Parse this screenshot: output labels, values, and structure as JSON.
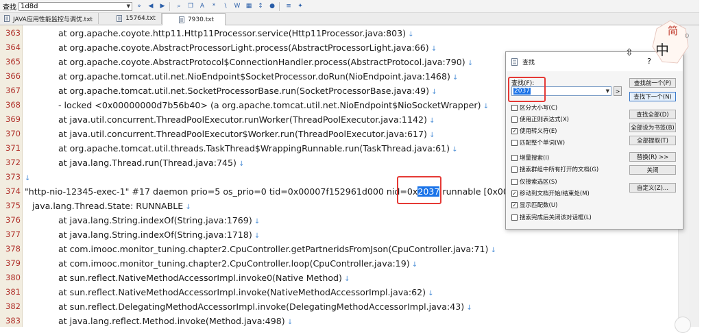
{
  "toolbar": {
    "search_label": "查找",
    "search_value": "1d8d"
  },
  "tabs": [
    {
      "label": "JAVA应用性能监控与调优.txt"
    },
    {
      "label": "15764.txt"
    },
    {
      "label": "7930.txt"
    }
  ],
  "editor": {
    "lines": [
      {
        "num": "363",
        "text": "at org.apache.coyote.http11.Http11Processor.service(Http11Processor.java:803)",
        "indent": 2
      },
      {
        "num": "364",
        "text": "at org.apache.coyote.AbstractProcessorLight.process(AbstractProcessorLight.java:66)",
        "indent": 2
      },
      {
        "num": "365",
        "text": "at org.apache.coyote.AbstractProtocol$ConnectionHandler.process(AbstractProtocol.java:790)",
        "indent": 2
      },
      {
        "num": "366",
        "text": "at org.apache.tomcat.util.net.NioEndpoint$SocketProcessor.doRun(NioEndpoint.java:1468)",
        "indent": 2
      },
      {
        "num": "367",
        "text": "at org.apache.tomcat.util.net.SocketProcessorBase.run(SocketProcessorBase.java:49)",
        "indent": 2
      },
      {
        "num": "368",
        "text": "- locked <0x00000000d7b56b40> (a org.apache.tomcat.util.net.NioEndpoint$NioSocketWrapper)",
        "indent": 2
      },
      {
        "num": "369",
        "text": "at java.util.concurrent.ThreadPoolExecutor.runWorker(ThreadPoolExecutor.java:1142)",
        "indent": 2
      },
      {
        "num": "370",
        "text": "at java.util.concurrent.ThreadPoolExecutor$Worker.run(ThreadPoolExecutor.java:617)",
        "indent": 2
      },
      {
        "num": "371",
        "text": "at org.apache.tomcat.util.threads.TaskThread$WrappingRunnable.run(TaskThread.java:61)",
        "indent": 2
      },
      {
        "num": "372",
        "text": "at java.lang.Thread.run(Thread.java:745)",
        "indent": 2
      },
      {
        "num": "373",
        "text": "",
        "indent": 0
      },
      {
        "num": "374",
        "pre": "\"http-nio-12345-exec-1\" #17 daemon prio=5 os_prio=0 tid=0x00007f152961d000 nid=0x",
        "match": "2037",
        "post": " runnable [0x0000",
        "indent": 0
      },
      {
        "num": "375",
        "text": "java.lang.Thread.State: RUNNABLE",
        "indent": 1
      },
      {
        "num": "376",
        "text": "at java.lang.String.indexOf(String.java:1769)",
        "indent": 2
      },
      {
        "num": "377",
        "text": "at java.lang.String.indexOf(String.java:1718)",
        "indent": 2
      },
      {
        "num": "378",
        "text": "at com.imooc.monitor_tuning.chapter2.CpuController.getPartneridsFromJson(CpuController.java:71)",
        "indent": 2
      },
      {
        "num": "379",
        "text": "at com.imooc.monitor_tuning.chapter2.CpuController.loop(CpuController.java:19)",
        "indent": 2
      },
      {
        "num": "380",
        "text": "at sun.reflect.NativeMethodAccessorImpl.invoke0(Native Method)",
        "indent": 2
      },
      {
        "num": "381",
        "text": "at sun.reflect.NativeMethodAccessorImpl.invoke(NativeMethodAccessorImpl.java:62)",
        "indent": 2
      },
      {
        "num": "382",
        "text": "at sun.reflect.DelegatingMethodAccessorImpl.invoke(DelegatingMethodAccessorImpl.java:43)",
        "indent": 2
      },
      {
        "num": "383",
        "text": "at java.lang.reflect.Method.invoke(Method.java:498)",
        "indent": 2
      }
    ]
  },
  "find_dialog": {
    "title": "查找",
    "help": "?",
    "find_label": "查找(F):",
    "find_value": "2037",
    "options": [
      {
        "label": "区分大小写(C)",
        "checked": false
      },
      {
        "label": "使用正则表达式(X)",
        "checked": false
      },
      {
        "label": "使用转义符(E)",
        "checked": true
      },
      {
        "label": "匹配整个单词(W)",
        "checked": false
      },
      {
        "label": "增量搜索(I)",
        "checked": false
      },
      {
        "label": "搜索群组中所有打开的文档(G)",
        "checked": false
      },
      {
        "label": "仅搜索选区(S)",
        "checked": false
      },
      {
        "label": "移动到文档开始/结束处(M)",
        "checked": true
      },
      {
        "label": "显示匹配数(U)",
        "checked": true
      },
      {
        "label": "搜索完成后关闭该对话框(L)",
        "checked": false
      }
    ],
    "buttons": {
      "find_prev": "查找前一个(P)",
      "find_next": "查找下一个(N)",
      "find_all": "查找全部(D)",
      "bookmark_all": "全部设为书签(B)",
      "extract_all": "全部提取(T)",
      "replace": "替换(R) >>",
      "close": "关闭",
      "custom": "自定义(Z)..."
    }
  },
  "deco": {
    "char1": "简",
    "char2": "中"
  }
}
